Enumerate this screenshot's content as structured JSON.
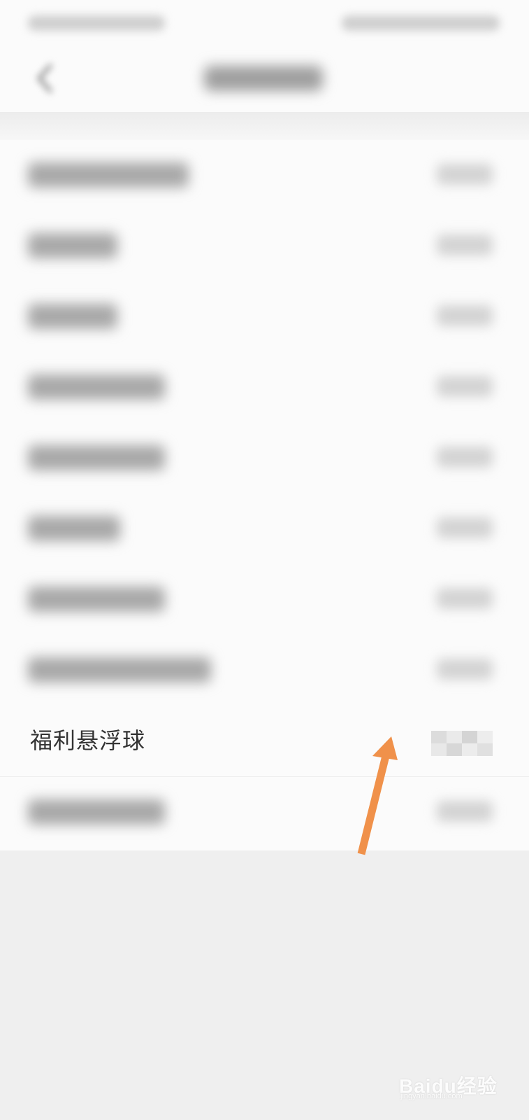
{
  "status_bar": {
    "left": "",
    "right": ""
  },
  "header": {
    "title": ""
  },
  "settings": {
    "highlighted_item": {
      "label": "福利悬浮球"
    }
  },
  "watermark": {
    "text": "Baidu经验",
    "sub": "jingyan.baidu.com"
  },
  "annotation": {
    "arrow_color": "#F0914A"
  }
}
